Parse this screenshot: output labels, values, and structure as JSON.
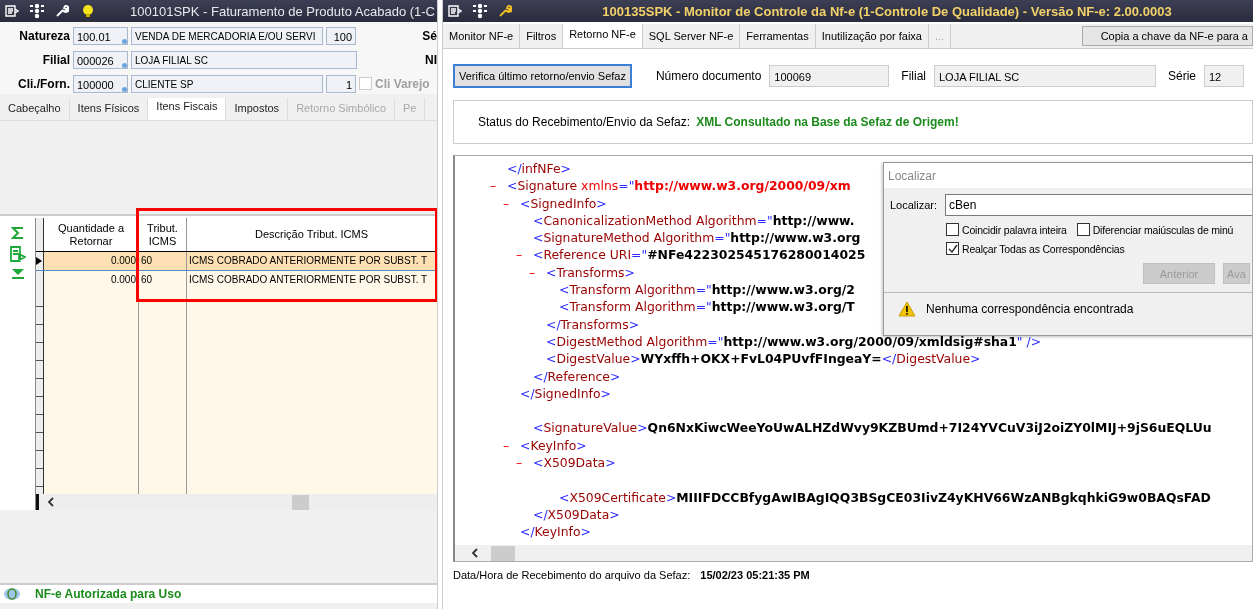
{
  "left_window": {
    "title": "100101SPK - Faturamento de Produto Acabado (1-C",
    "form_rows": [
      {
        "label": "Natureza",
        "code": "100.01",
        "description": "VENDA DE MERCADORIA E/OU SERVI",
        "extra": "100",
        "side_label": "Sé"
      },
      {
        "label": "Filial",
        "code": "000026",
        "description": "LOJA FILIAL SC",
        "side_label": "NI"
      },
      {
        "label": "Cli./Forn.",
        "code": "100000",
        "description": "CLIENTE SP",
        "extra": "1",
        "checkbox": {
          "label": "Cli Varejo",
          "checked": false
        }
      }
    ],
    "tabs": [
      {
        "label": "Cabeçalho",
        "selected": false,
        "disabled": false
      },
      {
        "label": "Itens Físicos",
        "selected": false,
        "disabled": false
      },
      {
        "label": "Itens Fiscais",
        "selected": true,
        "disabled": false
      },
      {
        "label": "Impostos",
        "selected": false,
        "disabled": false
      },
      {
        "label": "Retorno Simbólico",
        "selected": false,
        "disabled": true
      },
      {
        "label": "Pe",
        "selected": false,
        "disabled": true
      }
    ],
    "grid": {
      "columns": [
        "Quantidade a Retornar",
        "Tribut. ICMS",
        "Descrição Tribut. ICMS"
      ],
      "rows": [
        {
          "cells": [
            "0.000",
            "60",
            "ICMS COBRADO ANTERIORMENTE POR SUBST. T"
          ],
          "selected": true
        },
        {
          "cells": [
            "0.000",
            "60",
            "ICMS COBRADO ANTERIORMENTE POR SUBST. T"
          ],
          "selected": false
        }
      ]
    },
    "status": "NF-e Autorizada para Uso"
  },
  "right_window": {
    "title": "100135SPK - Monitor de Controle da Nf-e (1-Controle De Qualidade) - Versão NF-e: 2.00.0003",
    "tabs": [
      {
        "label": "Monitor NF-e",
        "selected": false,
        "disabled": false
      },
      {
        "label": "Filtros",
        "selected": false,
        "disabled": false
      },
      {
        "label": "Retorno NF-e",
        "selected": true,
        "disabled": false
      },
      {
        "label": "SQL Server NF-e",
        "selected": false,
        "disabled": false
      },
      {
        "label": "Ferramentas",
        "selected": false,
        "disabled": false
      },
      {
        "label": "Inutilização por faixa",
        "selected": false,
        "disabled": false
      },
      {
        "label": "...",
        "selected": false,
        "disabled": true
      }
    ],
    "copy_button": "Copia a chave da NF-e para a",
    "verify_button": "Verifica último retorno/envio Sefaz",
    "fields": [
      {
        "label": "Número documento",
        "value": "100069"
      },
      {
        "label": "Filial",
        "value": "LOJA FILIAL SC"
      },
      {
        "label": "Série",
        "value": "12"
      }
    ],
    "status_label": "Status do Recebimento/Envio da Sefaz:",
    "status_value": "XML Consultado na Base da Sefaz de Origem!",
    "xml": [
      {
        "parts": [
          {
            "punct": "</"
          },
          {
            "tag": "infNFe"
          },
          {
            "punct": ">"
          }
        ]
      },
      {
        "parts": [
          {
            "toggle": "–"
          },
          {
            "punct": "<"
          },
          {
            "tag": "Signature"
          },
          {
            "ns": " xmlns"
          },
          {
            "punct": "=\""
          },
          {
            "nsvalue": "http://www.w3.org/2000/09/xm"
          }
        ],
        "children": [
          {
            "parts": [
              {
                "toggle": "–"
              },
              {
                "punct": "<"
              },
              {
                "tag": "SignedInfo"
              },
              {
                "punct": ">"
              }
            ],
            "children": [
              {
                "parts": [
                  {
                    "punct": "<"
                  },
                  {
                    "tag": "CanonicalizationMethod"
                  },
                  {
                    "attr": " Algorithm"
                  },
                  {
                    "punct": "=\""
                  },
                  {
                    "value": "http://www."
                  }
                ]
              },
              {
                "parts": [
                  {
                    "punct": "<"
                  },
                  {
                    "tag": "SignatureMethod"
                  },
                  {
                    "attr": " Algorithm"
                  },
                  {
                    "punct": "=\""
                  },
                  {
                    "value": "http://www.w3.org"
                  }
                ]
              },
              {
                "parts": [
                  {
                    "toggle": "–"
                  },
                  {
                    "punct": "<"
                  },
                  {
                    "tag": "Reference"
                  },
                  {
                    "attr": " URI"
                  },
                  {
                    "punct": "=\""
                  },
                  {
                    "value": "#NFe422302545176280014025"
                  }
                ],
                "children": [
                  {
                    "parts": [
                      {
                        "toggle": "–"
                      },
                      {
                        "punct": "<"
                      },
                      {
                        "tag": "Transforms"
                      },
                      {
                        "punct": ">"
                      }
                    ],
                    "children": [
                      {
                        "parts": [
                          {
                            "punct": "<"
                          },
                          {
                            "tag": "Transform"
                          },
                          {
                            "attr": " Algorithm"
                          },
                          {
                            "punct": "=\""
                          },
                          {
                            "value": "http://www.w3.org/2"
                          }
                        ]
                      },
                      {
                        "parts": [
                          {
                            "punct": "<"
                          },
                          {
                            "tag": "Transform"
                          },
                          {
                            "attr": " Algorithm"
                          },
                          {
                            "punct": "=\""
                          },
                          {
                            "value": "http://www.w3.org/T"
                          }
                        ]
                      }
                    ],
                    "close": [
                      {
                        "punct": "</"
                      },
                      {
                        "tag": "Transforms"
                      },
                      {
                        "punct": ">"
                      }
                    ]
                  },
                  {
                    "parts": [
                      {
                        "punct": "<"
                      },
                      {
                        "tag": "DigestMethod"
                      },
                      {
                        "attr": " Algorithm"
                      },
                      {
                        "punct": "=\""
                      },
                      {
                        "value": "http://www.w3.org/2000/09/xmldsig#sha1"
                      },
                      {
                        "punct": "\" />"
                      }
                    ]
                  },
                  {
                    "parts": [
                      {
                        "punct": "<"
                      },
                      {
                        "tag": "DigestValue"
                      },
                      {
                        "punct": ">"
                      },
                      {
                        "value": "WYxffh+OKX+FvL04PUvfFIngeaY="
                      },
                      {
                        "punct": "</"
                      },
                      {
                        "tag": "DigestValue"
                      },
                      {
                        "punct": ">"
                      }
                    ]
                  }
                ],
                "close": [
                  {
                    "punct": "</"
                  },
                  {
                    "tag": "Reference"
                  },
                  {
                    "punct": ">"
                  }
                ]
              }
            ],
            "close": [
              {
                "punct": "</"
              },
              {
                "tag": "SignedInfo"
              },
              {
                "punct": ">"
              }
            ]
          },
          {
            "children": [
              {
                "parts": [
                  {
                    "punct": "<"
                  },
                  {
                    "tag": "SignatureValue"
                  },
                  {
                    "punct": ">"
                  },
                  {
                    "value": "Qn6NxKiwcWeeYoUwALHZdWvy9KZBUmd+7I24YVCuV3iJ2oiZY0lMIJ+9jS6uEQLUu"
                  }
                ]
              }
            ]
          },
          {
            "parts": [
              {
                "toggle": "–"
              },
              {
                "punct": "<"
              },
              {
                "tag": "KeyInfo"
              },
              {
                "punct": ">"
              }
            ],
            "children": [
              {
                "parts": [
                  {
                    "toggle": "–"
                  },
                  {
                    "punct": "<"
                  },
                  {
                    "tag": "X509Data"
                  },
                  {
                    "punct": ">"
                  }
                ],
                "children": [
                  {
                    "children": [
                      {
                        "parts": [
                          {
                            "punct": "<"
                          },
                          {
                            "tag": "X509Certificate"
                          },
                          {
                            "punct": ">"
                          },
                          {
                            "value": "MIIIFDCCBfygAwIBAgIQQ3BSgCE03IivZ4yKHV66WzANBgkqhkiG9w0BAQsFAD"
                          }
                        ]
                      }
                    ]
                  }
                ],
                "close": [
                  {
                    "punct": "</"
                  },
                  {
                    "tag": "X509Data"
                  },
                  {
                    "punct": ">"
                  }
                ]
              }
            ],
            "close": [
              {
                "punct": "</"
              },
              {
                "tag": "KeyInfo"
              },
              {
                "punct": ">"
              }
            ]
          }
        ]
      }
    ],
    "received_label": "Data/Hora de Recebimento do arquivo da Sefaz:",
    "received_value": "15/02/23 05:21:35 PM",
    "find_dialog": {
      "title": "Localizar",
      "label": "Localizar:",
      "value": "cBen",
      "options": [
        {
          "label": "Coincidir palavra inteira",
          "checked": false
        },
        {
          "label": "Diferenciar maiúsculas de minú",
          "checked": false
        },
        {
          "label": "Realçar Todas as Correspondências",
          "checked": true
        }
      ],
      "buttons": [
        {
          "label": "Anterior",
          "disabled": true
        },
        {
          "label": "Ava",
          "disabled": true
        }
      ],
      "message": "Nenhuma correspondência encontrada"
    }
  }
}
